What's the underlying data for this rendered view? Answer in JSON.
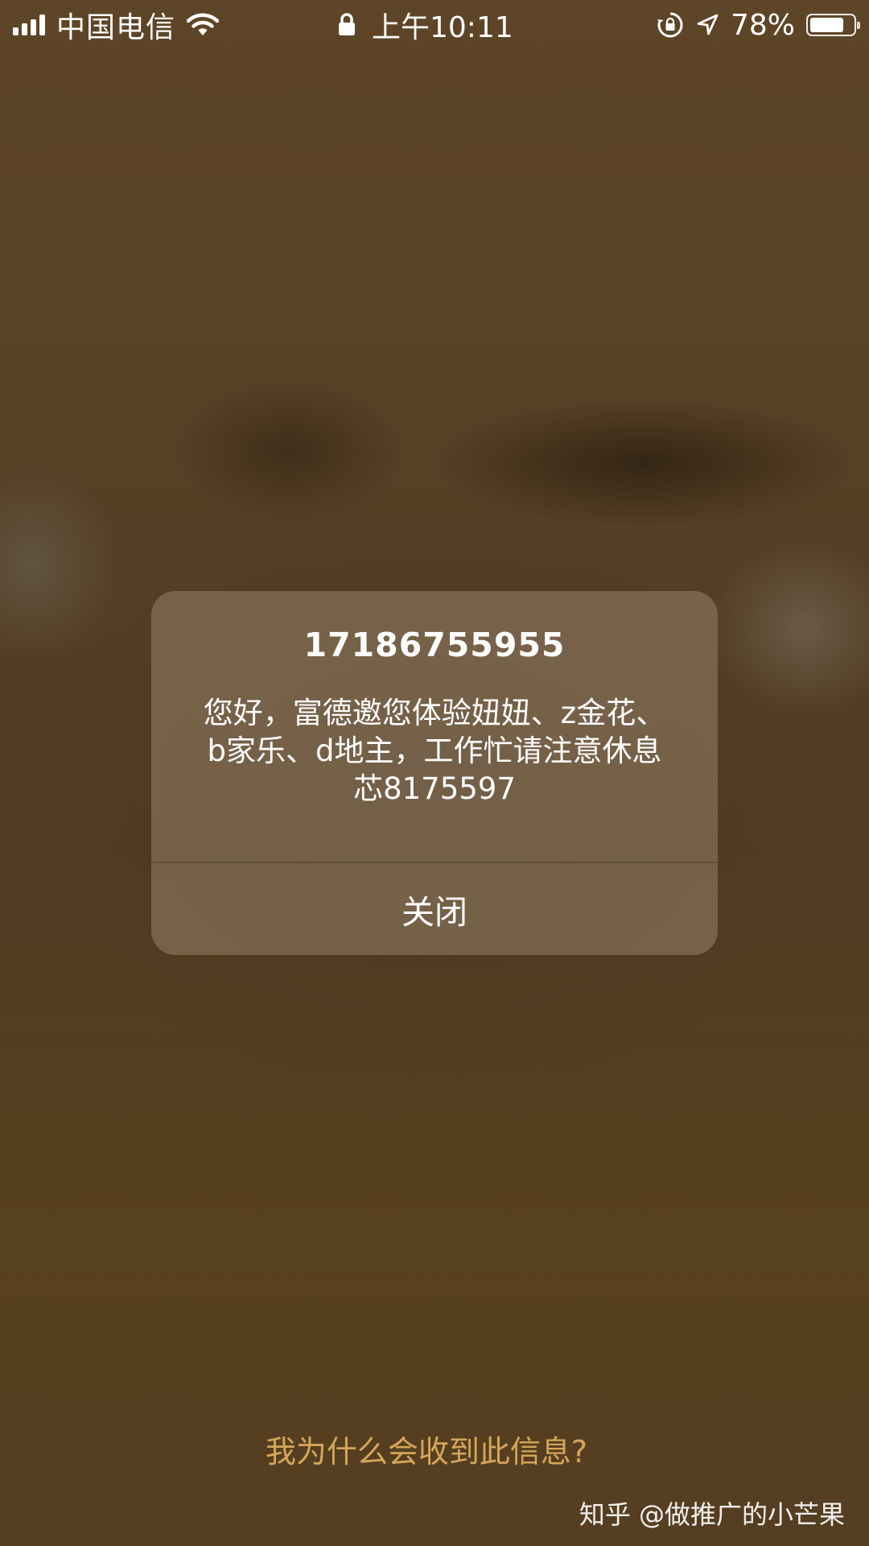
{
  "status_bar": {
    "carrier": "中国电信",
    "time": "上午10:11",
    "battery_percent": "78%",
    "battery_level": 0.78,
    "signal_bars": 4,
    "icons": [
      "signal-icon",
      "wifi-icon",
      "lock-icon",
      "rotation-lock-icon",
      "location-icon",
      "battery-icon"
    ]
  },
  "alert": {
    "title": "17186755955",
    "message": "您好，富德邀您体验妞妞、z金花、b家乐、d地主，工作忙请注意休息芯8175597",
    "close_label": "关闭"
  },
  "footer": {
    "why_link": "我为什么会收到此信息?",
    "watermark": "知乎 @做推广的小芒果"
  },
  "colors": {
    "background": "#553f26",
    "link": "#d6a658",
    "text": "#ffffff"
  }
}
